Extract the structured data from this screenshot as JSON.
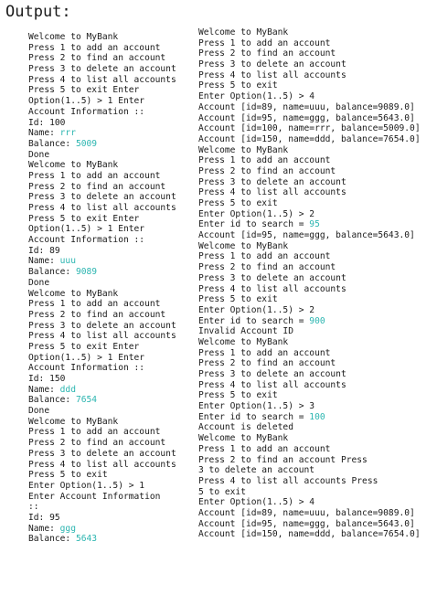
{
  "heading": "Output:",
  "colors": {
    "input": "#2bb5b0",
    "text": "#1a1a1a"
  },
  "left_lines": [
    [
      "Welcome to MyBank"
    ],
    [
      "Press 1 to add an account"
    ],
    [
      "Press 2 to find an account"
    ],
    [
      "Press 3 to delete an account"
    ],
    [
      "Press 4 to list all accounts"
    ],
    [
      "Press 5 to exit Enter"
    ],
    [
      "Option(1..5) > 1 Enter"
    ],
    [
      "Account Information ::"
    ],
    [
      "Id: 100"
    ],
    [
      "Name: ",
      "rrr"
    ],
    [
      "Balance: ",
      "5009"
    ],
    [
      "Done"
    ],
    [
      "Welcome to MyBank"
    ],
    [
      "Press 1 to add an account"
    ],
    [
      "Press 2 to find an account"
    ],
    [
      "Press 3 to delete an account"
    ],
    [
      "Press 4 to list all accounts"
    ],
    [
      "Press 5 to exit Enter"
    ],
    [
      "Option(1..5) > 1 Enter"
    ],
    [
      "Account Information ::"
    ],
    [
      "Id: 89"
    ],
    [
      "Name: ",
      "uuu"
    ],
    [
      "Balance: ",
      "9089"
    ],
    [
      "Done"
    ],
    [
      "Welcome to MyBank"
    ],
    [
      "Press 1 to add an account"
    ],
    [
      "Press 2 to find an account"
    ],
    [
      "Press 3 to delete an account"
    ],
    [
      "Press 4 to list all accounts"
    ],
    [
      "Press 5 to exit Enter"
    ],
    [
      "Option(1..5) > 1 Enter"
    ],
    [
      "Account Information ::"
    ],
    [
      "Id: 150"
    ],
    [
      "Name: ",
      "ddd"
    ],
    [
      "Balance: ",
      "7654"
    ],
    [
      "Done"
    ],
    [
      "Welcome to MyBank"
    ],
    [
      "Press 1 to add an account"
    ],
    [
      "Press 2 to find an account"
    ],
    [
      "Press 3 to delete an account"
    ],
    [
      "Press 4 to list all accounts"
    ],
    [
      "Press 5 to exit"
    ],
    [
      "Enter Option(1..5) > 1"
    ],
    [
      "Enter Account Information"
    ],
    [
      "::"
    ],
    [
      "Id: 95"
    ],
    [
      "Name: ",
      "ggg"
    ],
    [
      "Balance: ",
      "5643"
    ]
  ],
  "right_lines": [
    [
      "Welcome to MyBank"
    ],
    [
      "Press 1 to add an account"
    ],
    [
      "Press 2 to find an account"
    ],
    [
      "Press 3 to delete an account"
    ],
    [
      "Press 4 to list all accounts"
    ],
    [
      "Press 5 to exit"
    ],
    [
      "Enter Option(1..5) > 4"
    ],
    [
      "Account [id=89, name=uuu, balance=9089.0]"
    ],
    [
      "Account [id=95, name=ggg, balance=5643.0]"
    ],
    [
      "Account [id=100, name=rrr, balance=5009.0]"
    ],
    [
      "Account [id=150, name=ddd, balance=7654.0]"
    ],
    [
      "Welcome to MyBank"
    ],
    [
      "Press 1 to add an account"
    ],
    [
      "Press 2 to find an account"
    ],
    [
      "Press 3 to delete an account"
    ],
    [
      "Press 4 to list all accounts"
    ],
    [
      "Press 5 to exit"
    ],
    [
      "Enter Option(1..5) > 2"
    ],
    [
      "Enter id to search = ",
      "95"
    ],
    [
      "Account [id=95, name=ggg, balance=5643.0]"
    ],
    [
      "Welcome to MyBank"
    ],
    [
      "Press 1 to add an account"
    ],
    [
      "Press 2 to find an account"
    ],
    [
      "Press 3 to delete an account"
    ],
    [
      "Press 4 to list all accounts"
    ],
    [
      "Press 5 to exit"
    ],
    [
      "Enter Option(1..5) > 2"
    ],
    [
      "Enter id to search = ",
      "900"
    ],
    [
      "Invalid Account ID"
    ],
    [
      "Welcome to MyBank"
    ],
    [
      "Press 1 to add an account"
    ],
    [
      "Press 2 to find an account"
    ],
    [
      "Press 3 to delete an account"
    ],
    [
      "Press 4 to list all accounts"
    ],
    [
      "Press 5 to exit"
    ],
    [
      "Enter Option(1..5) > 3"
    ],
    [
      "Enter id to search = ",
      "100"
    ],
    [
      "Account is deleted"
    ],
    [
      "Welcome to MyBank"
    ],
    [
      "Press 1 to add an account"
    ],
    [
      "Press 2 to find an account Press"
    ],
    [
      "3 to delete an account"
    ],
    [
      "Press 4 to list all accounts Press"
    ],
    [
      "5 to exit"
    ],
    [
      "Enter Option(1..5) > 4"
    ],
    [
      "Account [id=89, name=uuu, balance=9089.0]"
    ],
    [
      "Account [id=95, name=ggg, balance=5643.0]"
    ],
    [
      "Account [id=150, name=ddd, balance=7654.0]"
    ]
  ]
}
